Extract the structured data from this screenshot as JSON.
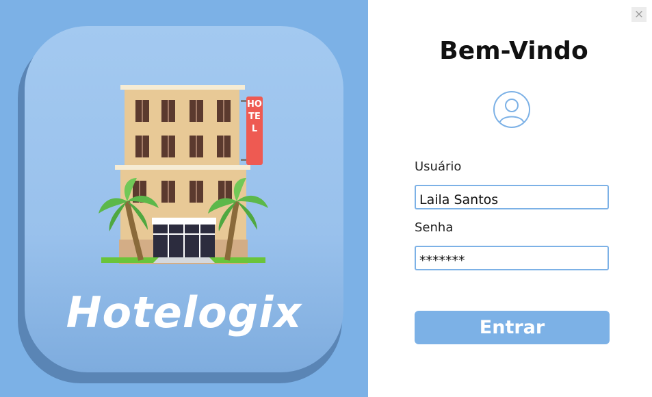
{
  "brand": {
    "name": "Hotelogix",
    "sign": "HOTEL"
  },
  "login": {
    "title": "Bem-Vindo",
    "username_label": "Usuário",
    "username_value": "Laila Santos",
    "password_label": "Senha",
    "password_value": "*******",
    "submit_label": "Entrar"
  },
  "window": {
    "close_glyph": "×"
  },
  "icons": {
    "avatar": "user-circle-icon",
    "close": "close-icon"
  },
  "colors": {
    "accent": "#7cb1e6",
    "panel_bg": "#7cb1e6",
    "sign_red": "#ee5a52",
    "palm_green": "#6ac43a"
  }
}
